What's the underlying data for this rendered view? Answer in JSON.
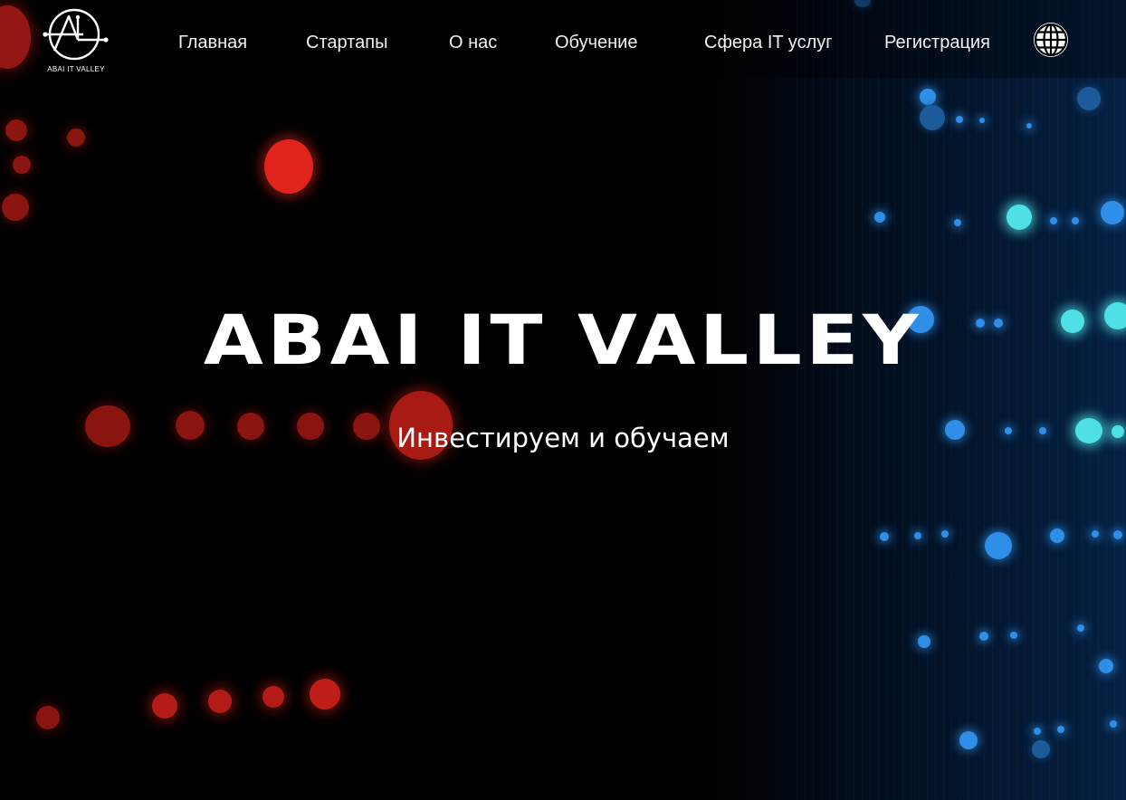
{
  "brand": {
    "logo_text": "ABAI IT VALLEY"
  },
  "nav": {
    "items": [
      {
        "label": "Главная"
      },
      {
        "label": "Стартапы"
      },
      {
        "label": "О нас"
      },
      {
        "label": "Обучение"
      },
      {
        "label": "Сфера IT услуг"
      },
      {
        "label": "Регистрация"
      }
    ],
    "language_icon": "globe-icon"
  },
  "hero": {
    "title": "ABAI IT VALLEY",
    "subtitle": "Инвестируем и обучаем"
  },
  "colors": {
    "background": "#000000",
    "text": "#ffffff",
    "accent_red": "#e0241c",
    "accent_blue": "#2f8fe8",
    "accent_cyan": "#4fe0e6"
  }
}
